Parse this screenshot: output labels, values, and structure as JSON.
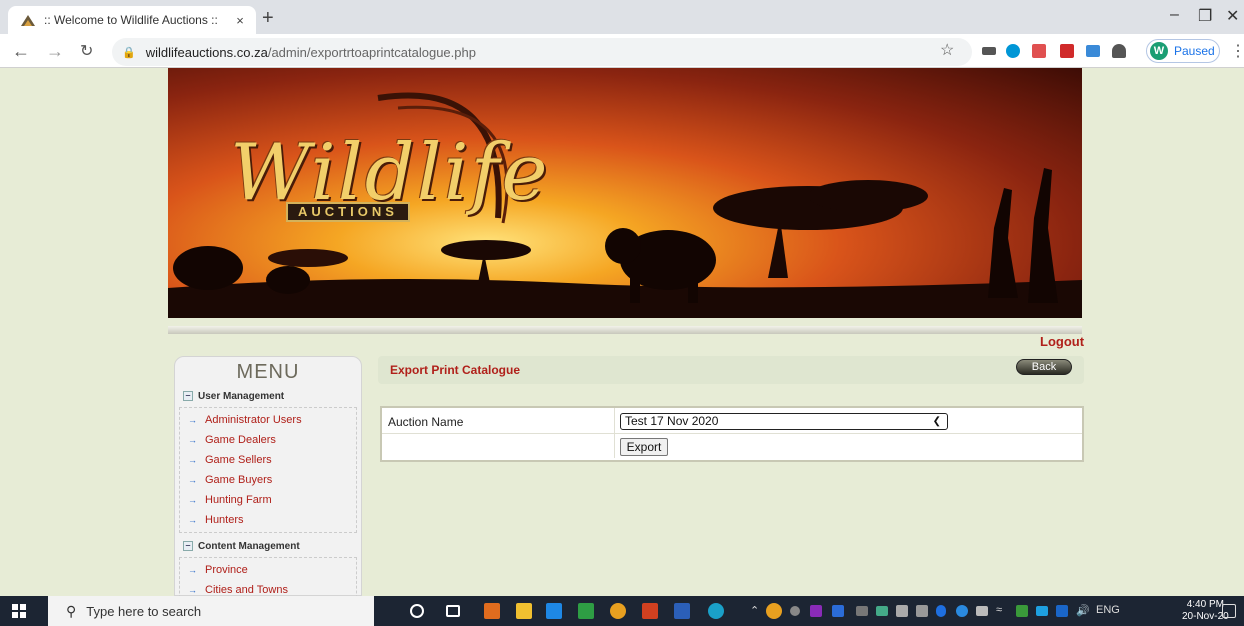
{
  "browser": {
    "tab_title": ":: Welcome to Wildlife Auctions ::",
    "tab_close": "×",
    "new_tab": "+",
    "url_host": "wildlifeauctions.co.za",
    "url_path": "/admin/exportrtoaprintcatalogue.php",
    "profile_initial": "W",
    "profile_status": "Paused"
  },
  "header": {
    "logo_script": "Wildlife",
    "logo_sub": "AUCTIONS",
    "logout": "Logout"
  },
  "menu": {
    "title": "MENU",
    "sections": [
      {
        "label": "User Management",
        "items": [
          "Administrator Users",
          "Game Dealers",
          "Game Sellers",
          "Game Buyers",
          "Hunting Farm",
          "Hunters"
        ]
      },
      {
        "label": "Content Management",
        "items": [
          "Province",
          "Cities and Towns"
        ]
      }
    ]
  },
  "main": {
    "title": "Export Print Catalogue",
    "back_label": "Back",
    "auction_label": "Auction Name",
    "auction_selected": "Test 17 Nov 2020",
    "export_label": "Export"
  },
  "taskbar": {
    "search_placeholder": "Type here to search",
    "language": "ENG",
    "time": "4:40 PM",
    "date": "20-Nov-20"
  }
}
